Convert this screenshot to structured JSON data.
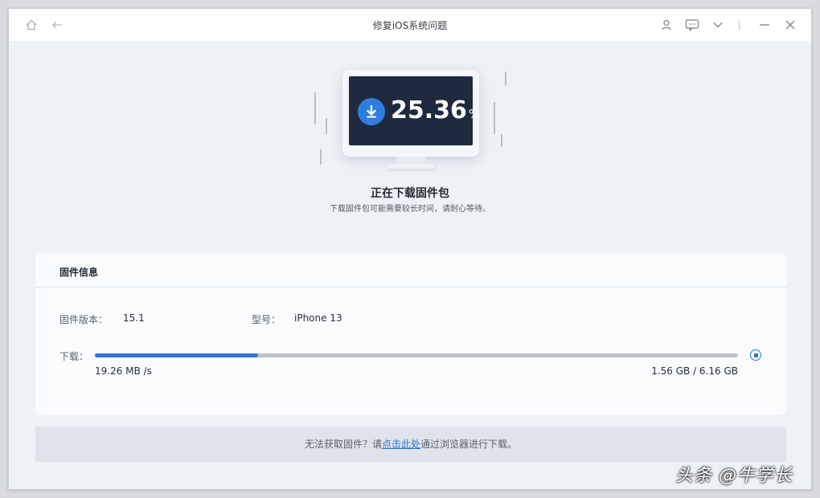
{
  "window": {
    "title": "修复iOS系统问题"
  },
  "toolbar": {
    "icons": [
      "home-icon",
      "back-icon",
      "user-icon",
      "feedback-icon",
      "chevron-down-icon",
      "minimize-icon",
      "close-icon"
    ]
  },
  "progress": {
    "percent_text": "25.36",
    "percent_sign": "%",
    "status_title": "正在下载固件包",
    "status_subtitle": "下载固件包可能需要较长时间，请耐心等待。"
  },
  "firmware_panel": {
    "heading": "固件信息",
    "version_label": "固件版本：",
    "version_value": "15.1",
    "model_label": "型号：",
    "model_value": "iPhone 13",
    "download_label": "下载：",
    "speed": "19.26 MB /s",
    "size_progress": "1.56 GB / 6.16 GB",
    "download_fraction": 0.2536
  },
  "footer": {
    "prefix": "无法获取固件？请",
    "link_text": "点击此处",
    "suffix": "通过浏览器进行下载。"
  },
  "watermark": "头条 @牛学长",
  "colors": {
    "accent": "#2f72d6",
    "screen": "#1f2a3f",
    "background": "#eef2f6"
  }
}
